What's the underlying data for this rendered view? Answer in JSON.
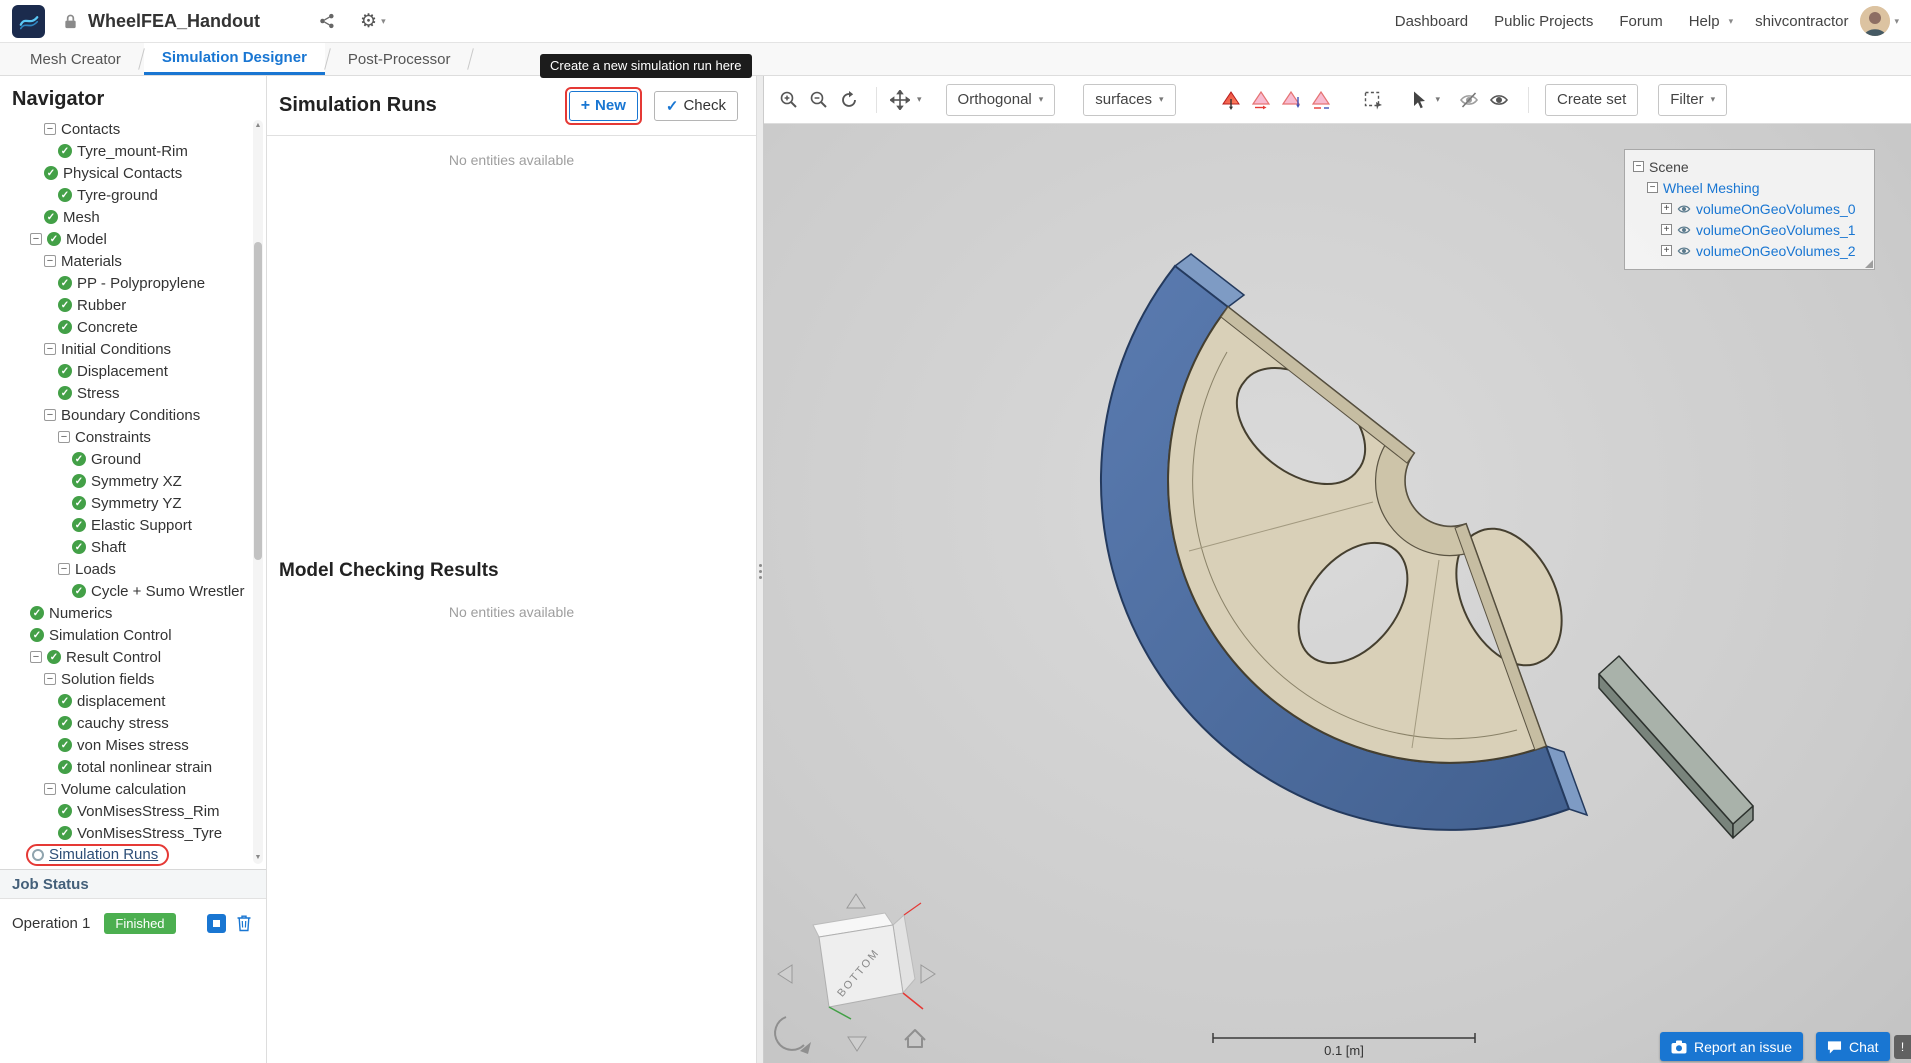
{
  "topbar": {
    "project_title": "WheelFEA_Handout",
    "nav_items": [
      {
        "label": "Dashboard",
        "chevron": false
      },
      {
        "label": "Public Projects",
        "chevron": false
      },
      {
        "label": "Forum",
        "chevron": false
      },
      {
        "label": "Help",
        "chevron": true
      }
    ],
    "username": "shivcontractor"
  },
  "tabs": [
    {
      "label": "Mesh Creator",
      "active": false
    },
    {
      "label": "Simulation Designer",
      "active": true
    },
    {
      "label": "Post-Processor",
      "active": false
    }
  ],
  "navigator": {
    "title": "Navigator",
    "tree": [
      {
        "label": "Contacts",
        "level": 2,
        "icons": [
          "collapse"
        ]
      },
      {
        "label": "Tyre_mount-Rim",
        "level": 3,
        "icons": [
          "check"
        ]
      },
      {
        "label": "Physical Contacts",
        "level": 2,
        "icons": [
          "check"
        ]
      },
      {
        "label": "Tyre-ground",
        "level": 3,
        "icons": [
          "check"
        ]
      },
      {
        "label": "Mesh",
        "level": 2,
        "icons": [
          "check"
        ]
      },
      {
        "label": "Model",
        "level": 1,
        "icons": [
          "collapse",
          "check"
        ]
      },
      {
        "label": "Materials",
        "level": 2,
        "icons": [
          "collapse"
        ]
      },
      {
        "label": "PP - Polypropylene",
        "level": 3,
        "icons": [
          "check"
        ]
      },
      {
        "label": "Rubber",
        "level": 3,
        "icons": [
          "check"
        ]
      },
      {
        "label": "Concrete",
        "level": 3,
        "icons": [
          "check"
        ]
      },
      {
        "label": "Initial Conditions",
        "level": 2,
        "icons": [
          "collapse"
        ]
      },
      {
        "label": "Displacement",
        "level": 3,
        "icons": [
          "check"
        ]
      },
      {
        "label": "Stress",
        "level": 3,
        "icons": [
          "check"
        ]
      },
      {
        "label": "Boundary Conditions",
        "level": 2,
        "icons": [
          "collapse"
        ]
      },
      {
        "label": "Constraints",
        "level": 3,
        "icons": [
          "collapse"
        ]
      },
      {
        "label": "Ground",
        "level": 4,
        "icons": [
          "check"
        ]
      },
      {
        "label": "Symmetry XZ",
        "level": 4,
        "icons": [
          "check"
        ]
      },
      {
        "label": "Symmetry YZ",
        "level": 4,
        "icons": [
          "check"
        ]
      },
      {
        "label": "Elastic Support",
        "level": 4,
        "icons": [
          "check"
        ]
      },
      {
        "label": "Shaft",
        "level": 4,
        "icons": [
          "check"
        ]
      },
      {
        "label": "Loads",
        "level": 3,
        "icons": [
          "collapse"
        ]
      },
      {
        "label": "Cycle + Sumo Wrestler",
        "level": 4,
        "icons": [
          "check"
        ]
      },
      {
        "label": "Numerics",
        "level": 1,
        "icons": [
          "check"
        ]
      },
      {
        "label": "Simulation Control",
        "level": 1,
        "icons": [
          "check"
        ]
      },
      {
        "label": "Result Control",
        "level": 1,
        "icons": [
          "collapse",
          "check"
        ]
      },
      {
        "label": "Solution fields",
        "level": 2,
        "icons": [
          "collapse"
        ]
      },
      {
        "label": "displacement",
        "level": 3,
        "icons": [
          "check"
        ]
      },
      {
        "label": "cauchy stress",
        "level": 3,
        "icons": [
          "check"
        ]
      },
      {
        "label": "von Mises stress",
        "level": 3,
        "icons": [
          "check"
        ]
      },
      {
        "label": "total nonlinear strain",
        "level": 3,
        "icons": [
          "check"
        ]
      },
      {
        "label": "Volume calculation",
        "level": 2,
        "icons": [
          "collapse"
        ]
      },
      {
        "label": "VonMisesStress_Rim",
        "level": 3,
        "icons": [
          "check"
        ]
      },
      {
        "label": "VonMisesStress_Tyre",
        "level": 3,
        "icons": [
          "check"
        ]
      },
      {
        "label": "Simulation Runs",
        "level": 1,
        "icons": [
          "circle"
        ],
        "highlight": true
      }
    ],
    "job_status": {
      "title": "Job Status",
      "operation": "Operation 1",
      "badge": "Finished"
    }
  },
  "runs_panel": {
    "title": "Simulation Runs",
    "new_label": "New",
    "check_label": "Check",
    "tooltip": "Create a new simulation run here",
    "empty_text": "No entities available",
    "model_checking_title": "Model Checking Results",
    "model_checking_empty": "No entities available"
  },
  "viewport": {
    "projection": "Orthogonal",
    "render_mode": "surfaces",
    "create_set_label": "Create set",
    "filter_label": "Filter",
    "scene_tree": {
      "root": "Scene",
      "group": "Wheel Meshing",
      "items": [
        "volumeOnGeoVolumes_0",
        "volumeOnGeoVolumes_1",
        "volumeOnGeoVolumes_2"
      ]
    },
    "scale_label": "0.1 [m]",
    "cube_face_label": "BOTTOM",
    "report_issue_label": "Report an issue",
    "chat_label": "Chat",
    "notification_label": "!"
  },
  "colors": {
    "accent_blue": "#1976d2",
    "success_green": "#43a047",
    "highlight_red": "#e53935",
    "tyre_blue": "#4f6fa1",
    "rim_tan": "#d9d0b8"
  }
}
